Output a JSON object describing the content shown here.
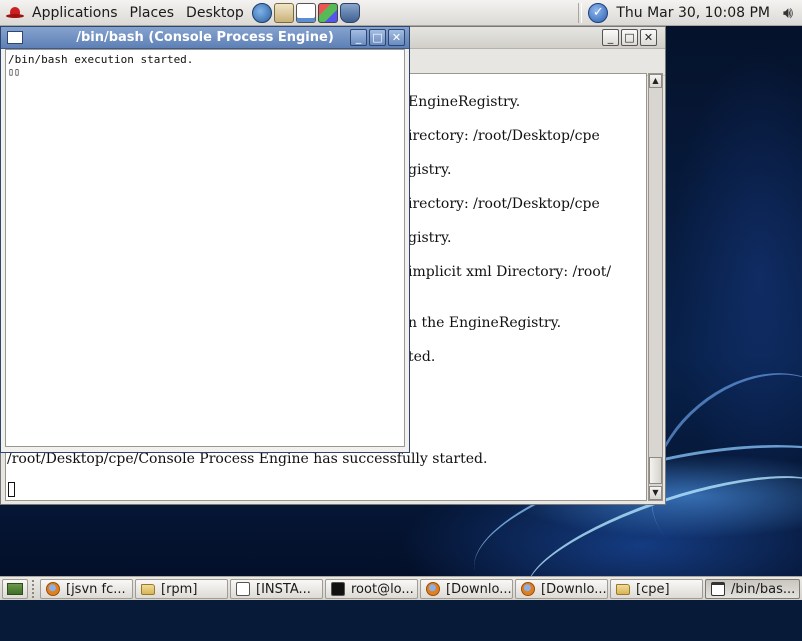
{
  "top_panel": {
    "menus": [
      "Applications",
      "Places",
      "Desktop"
    ],
    "clock": "Thu Mar 30, 10:08 PM",
    "launchers": [
      "browser-launcher-icon",
      "mail-launcher-icon",
      "writer-launcher-icon",
      "presentation-launcher-icon",
      "spreadsheet-launcher-icon"
    ]
  },
  "front_window": {
    "title": "/bin/bash (Console Process Engine)",
    "lines": [
      "/bin/bash execution started.",
      "▯▯"
    ]
  },
  "back_window": {
    "lines": [
      "EngineRegistry.",
      "irectory: /root/Desktop/cpe",
      "gistry.",
      "irectory: /root/Desktop/cpe",
      "gistry.",
      "implicit xml Directory: /root/",
      "n the EngineRegistry.",
      "ted."
    ],
    "full_line": "/root/Desktop/cpe/Console Process Engine has successfully started."
  },
  "taskbar": {
    "items": [
      {
        "label": "[jsvn fc...",
        "icon": "firefox-icon"
      },
      {
        "label": "[rpm]",
        "icon": "folder-icon"
      },
      {
        "label": "[INSTA...",
        "icon": "text-editor-icon"
      },
      {
        "label": "root@lo...",
        "icon": "terminal-icon"
      },
      {
        "label": "[Downlo...",
        "icon": "firefox-icon"
      },
      {
        "label": "[Downlo...",
        "icon": "firefox-icon"
      },
      {
        "label": "[cpe]",
        "icon": "folder-icon"
      },
      {
        "label": "/bin/bas...",
        "icon": "window-icon"
      }
    ]
  }
}
